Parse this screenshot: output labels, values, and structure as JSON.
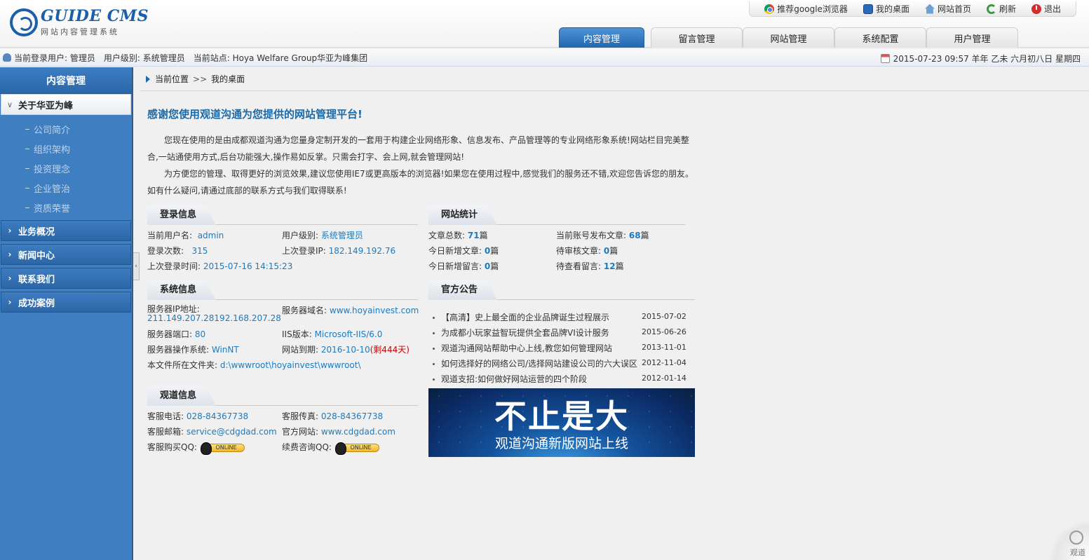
{
  "logo": {
    "title": "GUIDE CMS",
    "subtitle": "网站内容管理系统"
  },
  "toplinks": [
    {
      "label": "推荐google浏览器",
      "icon": "chrome-icon"
    },
    {
      "label": "我的桌面",
      "icon": "desktop-icon"
    },
    {
      "label": "网站首页",
      "icon": "home-icon"
    },
    {
      "label": "刷新",
      "icon": "refresh-icon"
    },
    {
      "label": "退出",
      "icon": "exit-icon"
    }
  ],
  "navtabs": [
    "内容管理",
    "留言管理",
    "网站管理",
    "系统配置",
    "用户管理"
  ],
  "infobar": {
    "current_user": "当前登录用户: 管理员",
    "user_level": "用户级别: 系统管理员",
    "current_site": "当前站点: Hoya Welfare Group华亚为峰集团",
    "datetime": "2015-07-23 09:57 羊年 乙未 六月初八日 星期四"
  },
  "sidebar": {
    "title": "内容管理",
    "open_group": "关于华亚为峰",
    "subitems": [
      "公司简介",
      "组织架构",
      "投资理念",
      "企业管治",
      "资质荣誉"
    ],
    "groups": [
      "业务概况",
      "新闻中心",
      "联系我们",
      "成功案例"
    ]
  },
  "breadcrumb": {
    "label": "当前位置",
    "sep": ">>",
    "page": "我的桌面"
  },
  "welcome": {
    "title": "感谢您使用观道沟通为您提供的网站管理平台!",
    "p1": "您现在使用的是由成都观道沟通为您量身定制开发的一套用于构建企业网络形象、信息发布、产品管理等的专业网络形象系统!网站栏目完美整合,一站通使用方式,后台功能强大,操作易如反掌。只需会打字、会上网,就会管理网站!",
    "p2": "为方便您的管理、取得更好的浏览效果,建议您使用IE7或更高版本的浏览器!如果您在使用过程中,感觉我们的服务还不错,欢迎您告诉您的朋友。如有什么疑问,请通过底部的联系方式与我们取得联系!"
  },
  "login_info": {
    "title": "登录信息",
    "username_label": "当前用户名:",
    "username": "admin",
    "level_label": "用户级别:",
    "level": "系统管理员",
    "count_label": "登录次数:",
    "count": "315",
    "last_ip_label": "上次登录IP:",
    "last_ip": "182.149.192.76",
    "last_time_label": "上次登录时间:",
    "last_time": "2015-07-16 14:15:23"
  },
  "site_stats": {
    "title": "网站统计",
    "total_label": "文章总数:",
    "total": "71",
    "unit": "篇",
    "mine_label": "当前账号发布文章:",
    "mine": "68",
    "today_label": "今日新增文章:",
    "today": "0",
    "pending_label": "待审核文章:",
    "pending": "0",
    "today_msg_label": "今日新增留言:",
    "today_msg": "0",
    "unread_msg_label": "待查看留言:",
    "unread_msg": "12"
  },
  "system_info": {
    "title": "系统信息",
    "ip_label": "服务器IP地址:",
    "ip": "211.149.207.28192.168.207.28",
    "domain_label": "服务器域名:",
    "domain": "www.hoyainvest.com",
    "port_label": "服务器端口:",
    "port": "80",
    "iis_label": "IIS版本:",
    "iis": "Microsoft-IIS/6.0",
    "os_label": "服务器操作系统:",
    "os": "WinNT",
    "expire_label": "网站到期:",
    "expire": "2016-10-10",
    "remain": "(剩444天)",
    "folder_label": "本文件所在文件夹:",
    "folder": "d:\\wwwroot\\hoyainvest\\wwwroot\\"
  },
  "notices": {
    "title": "官方公告",
    "items": [
      {
        "text": "【高清】史上最全面的企业品牌诞生过程展示",
        "date": "2015-07-02"
      },
      {
        "text": "为成都小玩家益智玩提供全套品牌VI设计服务",
        "date": "2015-06-26"
      },
      {
        "text": "观道沟通网站帮助中心上线,教您如何管理网站",
        "date": "2013-11-01"
      },
      {
        "text": "如何选择好的网络公司/选择网站建设公司的六大误区",
        "date": "2012-11-04"
      },
      {
        "text": "观道支招:如何做好网站运营的四个阶段",
        "date": "2012-01-14"
      }
    ]
  },
  "guandao_info": {
    "title": "观道信息",
    "phone_label": "客服电话:",
    "phone": "028-84367738",
    "fax_label": "客服传真:",
    "fax": "028-84367738",
    "email_label": "客服邮箱:",
    "email": "service@cdgdad.com",
    "site_label": "官方网站:",
    "site": "www.cdgdad.com",
    "buy_qq_label": "客服购买QQ:",
    "renew_qq_label": "续费咨询QQ:",
    "qq_badge": "ONLINE"
  },
  "banner": {
    "big": "不止是大",
    "small": "观道沟通新版网站上线"
  },
  "corner": {
    "label": "观道"
  }
}
